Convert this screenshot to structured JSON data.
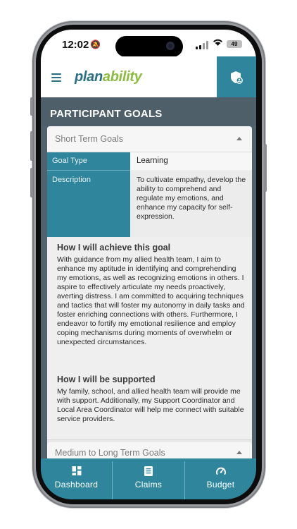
{
  "status_bar": {
    "time": "12:02",
    "battery": "49"
  },
  "header": {
    "logo_plan": "plan",
    "logo_ability": "ability"
  },
  "page": {
    "title": "PARTICIPANT GOALS"
  },
  "short_term": {
    "title": "Short Term Goals",
    "goal_type_label": "Goal Type",
    "goal_type_value": "Learning",
    "description_label": "Description",
    "description_value": "To cultivate empathy, develop the ability to comprehend and regulate my emotions, and enhance my capacity for self-expression.",
    "achieve_heading": "How I will achieve this goal",
    "achieve_text": "With guidance from my allied health team, I aim to enhance my aptitude in identifying and comprehending my emotions, as well as recognizing emotions in others. I aspire to effectively articulate my needs proactively, averting distress. I am committed to acquiring techniques and tactics that will foster my autonomy in daily tasks and foster enriching connections with others. Furthermore, I endeavor to fortify my emotional resilience and employ coping mechanisms during moments of overwhelm or unexpected circumstances.",
    "support_heading": "How I will be supported",
    "support_text": "My family, school, and allied health team will provide me with support. Additionally, my Support Coordinator and Local Area Coordinator will help me connect with suitable service providers."
  },
  "medium_long_term": {
    "title": "Medium to Long Term Goals"
  },
  "tabbar": {
    "dashboard": "Dashboard",
    "claims": "Claims",
    "budget": "Budget"
  },
  "colors": {
    "brand_teal": "#2e859c",
    "brand_green": "#8cbc3f",
    "band": "#4e5f69"
  }
}
